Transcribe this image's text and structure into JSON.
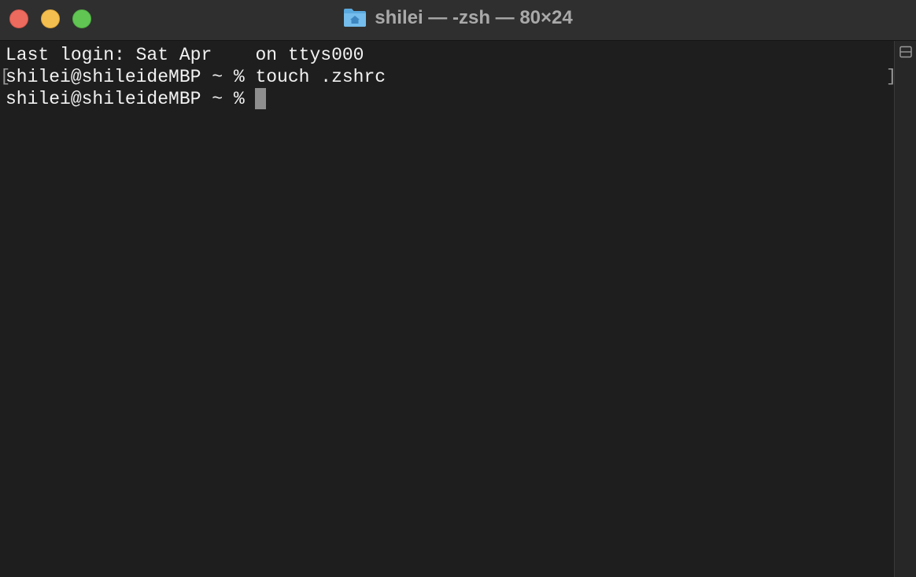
{
  "window": {
    "title": "shilei — -zsh — 80×24",
    "title_icon": "home-folder-icon"
  },
  "terminal": {
    "line1_prefix": "Last login: Sat Apr ",
    "line1_redacted": "  ",
    "line1_suffix": " on ttys000",
    "line2": "shilei@shileideMBP ~ % touch .zshrc",
    "line3_prompt": "shilei@shileideMBP ~ % ",
    "mark_left": "[",
    "mark_right": "]"
  },
  "scrollbar": {
    "split_icon": "split-pane-icon"
  },
  "colors": {
    "background": "#1e1e1e",
    "text": "#f2f2f2",
    "titlebar": "#2f2f2f",
    "close": "#ed6a5e",
    "minimize": "#f5bf4f",
    "zoom": "#61c554"
  }
}
